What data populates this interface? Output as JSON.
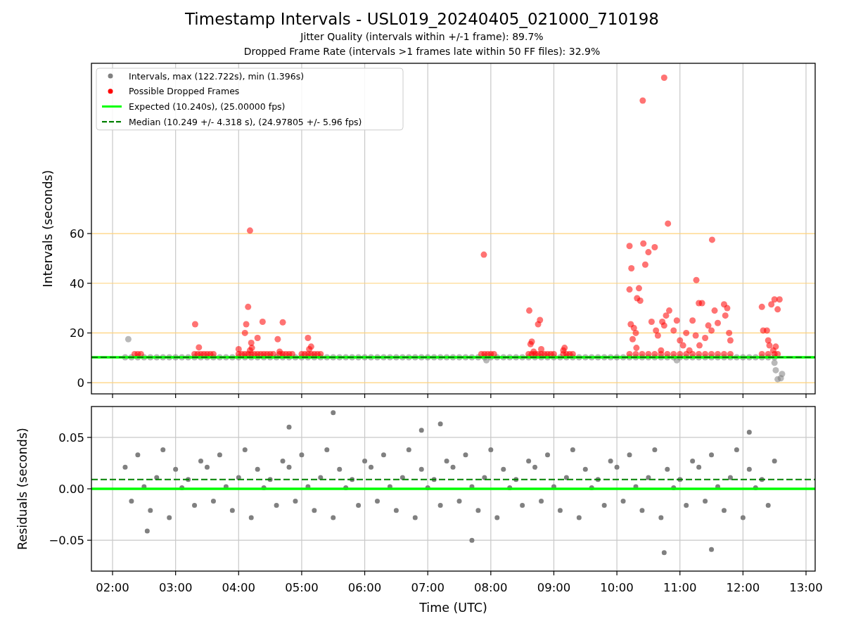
{
  "figure": {
    "title": "Timestamp Intervals - USL019_20240405_021000_710198",
    "subtitles": [
      "Jitter Quality (intervals within +/-1 frame): 89.7%",
      "Dropped Frame Rate (intervals >1 frames late within 50 FF files): 32.9%"
    ]
  },
  "panels": [
    {
      "chart_data": {
        "type": "scatter",
        "ylabel": "Intervals (seconds)",
        "xlim": [
          1.665,
          13.145
        ],
        "ylim": [
          -4.5,
          128.5
        ],
        "grid": true,
        "yticks": [
          0,
          20,
          40,
          60
        ],
        "series": [
          {
            "name": "Intervals, max (122.722s), min (1.396s)",
            "color": "#808080",
            "x": [
              2.2,
              2.3,
              2.4,
              2.5,
              2.6,
              2.7,
              2.8,
              2.9,
              3.0,
              3.1,
              3.2,
              3.3,
              3.4,
              3.5,
              3.6,
              3.7,
              3.8,
              3.9,
              4.0,
              4.1,
              4.2,
              4.3,
              4.4,
              4.5,
              4.6,
              4.7,
              4.8,
              4.9,
              5.0,
              5.1,
              5.2,
              5.3,
              5.4,
              5.5,
              5.6,
              5.7,
              5.8,
              5.9,
              6.0,
              6.1,
              6.2,
              6.3,
              6.4,
              6.5,
              6.6,
              6.7,
              6.8,
              6.9,
              7.0,
              7.1,
              7.2,
              7.3,
              7.4,
              7.5,
              7.6,
              7.7,
              7.8,
              7.9,
              8.0,
              8.1,
              8.2,
              8.3,
              8.4,
              8.5,
              8.6,
              8.7,
              8.8,
              8.9,
              9.0,
              9.1,
              9.2,
              9.3,
              9.4,
              9.5,
              9.6,
              9.7,
              9.8,
              9.9,
              10.0,
              10.1,
              10.2,
              10.3,
              10.4,
              10.5,
              10.6,
              10.7,
              10.8,
              10.9,
              11.0,
              11.1,
              11.2,
              11.3,
              11.4,
              11.5,
              11.6,
              11.7,
              11.8,
              11.9,
              12.0,
              12.1,
              12.2,
              12.3,
              12.4,
              12.5,
              2.25,
              7.93,
              10.95,
              12.5,
              12.52,
              12.55,
              12.6,
              12.62
            ],
            "values": [
              10.2,
              10.2,
              10.2,
              10.2,
              10.2,
              10.2,
              10.2,
              10.2,
              10.2,
              10.2,
              10.2,
              10.2,
              10.2,
              10.2,
              10.2,
              10.2,
              10.2,
              10.2,
              10.2,
              10.2,
              10.2,
              10.2,
              10.2,
              10.2,
              10.2,
              10.2,
              10.2,
              10.2,
              10.2,
              10.2,
              10.2,
              10.2,
              10.2,
              10.2,
              10.2,
              10.2,
              10.2,
              10.2,
              10.2,
              10.2,
              10.2,
              10.2,
              10.2,
              10.2,
              10.2,
              10.2,
              10.2,
              10.2,
              10.2,
              10.2,
              10.2,
              10.2,
              10.2,
              10.2,
              10.2,
              10.2,
              10.2,
              10.2,
              10.2,
              10.2,
              10.2,
              10.2,
              10.2,
              10.2,
              10.2,
              10.2,
              10.2,
              10.2,
              10.2,
              10.2,
              10.2,
              10.2,
              10.2,
              10.2,
              10.2,
              10.2,
              10.2,
              10.2,
              10.2,
              10.2,
              10.2,
              10.2,
              10.2,
              10.2,
              10.2,
              10.2,
              10.2,
              10.2,
              10.2,
              10.2,
              10.2,
              10.2,
              10.2,
              10.2,
              10.2,
              10.2,
              10.2,
              10.2,
              10.2,
              10.2,
              10.2,
              10.2,
              10.2,
              10.2,
              17.5,
              9.0,
              9.0,
              8,
              5,
              1.4,
              1.8,
              3.5
            ]
          },
          {
            "name": "Possible Dropped Frames",
            "color": "#ff0000",
            "x": [
              3.31,
              3.37,
              4.0,
              4.15,
              4.12,
              4.1,
              4.2,
              4.18,
              4.21,
              4.3,
              4.38,
              4.62,
              4.7,
              4.65,
              5.1,
              5.12,
              5.15,
              4.18,
              7.89,
              8.61,
              8.65,
              8.63,
              8.68,
              8.78,
              8.75,
              8.8,
              9.17,
              9.15,
              10.2,
              10.23,
              10.2,
              10.22,
              10.25,
              10.27,
              10.3,
              10.32,
              10.35,
              10.37,
              10.31,
              10.42,
              10.45,
              10.5,
              10.55,
              10.6,
              10.62,
              10.65,
              10.7,
              10.72,
              10.75,
              10.78,
              10.81,
              10.83,
              10.9,
              10.95,
              11.0,
              11.05,
              10.41,
              10.75,
              11.26,
              11.2,
              11.3,
              11.35,
              11.25,
              11.4,
              11.45,
              11.51,
              11.5,
              11.55,
              11.6,
              11.7,
              11.75,
              11.72,
              11.78,
              11.8,
              11.31,
              11.1,
              11.15,
              12.3,
              12.32,
              12.38,
              12.4,
              12.45,
              12.5,
              12.58,
              12.55,
              12.42,
              12.48,
              12.52,
              2.35,
              2.4,
              2.45,
              3.3,
              3.35,
              3.4,
              3.45,
              3.5,
              3.55,
              3.6,
              4.0,
              4.05,
              4.1,
              4.15,
              4.2,
              4.25,
              4.3,
              4.35,
              4.4,
              4.45,
              4.5,
              4.55,
              4.65,
              4.7,
              4.75,
              4.8,
              4.85,
              5.0,
              5.05,
              5.1,
              5.15,
              5.2,
              5.25,
              5.3,
              7.85,
              7.9,
              7.95,
              8.0,
              8.05,
              8.6,
              8.65,
              8.7,
              8.75,
              8.8,
              8.85,
              8.9,
              8.95,
              9.0,
              9.15,
              9.2,
              9.25,
              9.3,
              10.2,
              10.3,
              10.4,
              10.5,
              10.6,
              10.7,
              10.8,
              10.9,
              11.0,
              11.1,
              11.2,
              11.3,
              11.4,
              11.5,
              11.6,
              11.7,
              11.8,
              12.3,
              12.4,
              12.5,
              12.55
            ],
            "values": [
              23.5,
              14.2,
              13.5,
              30.5,
              23.5,
              20,
              16,
              13,
              14,
              18,
              24.5,
              17.5,
              24.3,
              12.5,
              18,
              13.5,
              14.5,
              61.2,
              51.5,
              29,
              16.5,
              15.5,
              12.5,
              25.2,
              23.5,
              13.5,
              14,
              13,
              55,
              46,
              37.5,
              23.5,
              17.5,
              22,
              20,
              34,
              38,
              33,
              14,
              56,
              47.5,
              52.5,
              24.5,
              54.5,
              21,
              19,
              13,
              24.5,
              23,
              27,
              64,
              29,
              21,
              25,
              17,
              15,
              113.5,
              122.7,
              41.3,
              25,
              32,
              32,
              19,
              18,
              23,
              57.5,
              21,
              29,
              24,
              31.5,
              30,
              27,
              20,
              17,
              15,
              20,
              13,
              30.5,
              21,
              21,
              17,
              31.5,
              33.5,
              33.5,
              29.5,
              15,
              13,
              14.5,
              11.5,
              11.5,
              11.5,
              11.5,
              11.5,
              11.5,
              11.5,
              11.5,
              11.5,
              11.5,
              11.5,
              11.5,
              11.5,
              11.5,
              11.5,
              11.5,
              11.5,
              11.5,
              11.5,
              11.5,
              11.5,
              11.5,
              11.5,
              11.5,
              11.5,
              11.5,
              11.5,
              11.5,
              11.5,
              11.5,
              11.5,
              11.5,
              11.5,
              11.5,
              11.5,
              11.5,
              11.5,
              11.5,
              11.5,
              11.5,
              11.5,
              11.5,
              11.5,
              11.5,
              11.5,
              11.5,
              11.5,
              11.5,
              11.5,
              11.5,
              11.5,
              11.5,
              11.5,
              11.5,
              11.5,
              11.5,
              11.5,
              11.5,
              11.5,
              11.5,
              11.5,
              11.5,
              11.5,
              11.5,
              11.5,
              11.5,
              11.5,
              11.5,
              11.5,
              11.5,
              11.5,
              11.5,
              11.5
            ]
          }
        ],
        "legend": true,
        "ref_lines": [
          {
            "label": "Expected (10.240s), (25.00000 fps)",
            "axis": "y",
            "value": 10.24,
            "color": "#00ff00"
          },
          {
            "label": "Median (10.249 +/- 4.318 s), (24.97805 +/- 5.96 fps)",
            "axis": "y",
            "value": 10.249,
            "color": "#008000"
          }
        ]
      }
    },
    {
      "chart_data": {
        "type": "scatter",
        "xlabel": "Time (UTC)",
        "ylabel": "Residuals (seconds)",
        "xlim": [
          1.665,
          13.145
        ],
        "ylim": [
          -0.08,
          0.08
        ],
        "grid": true,
        "xticks": [
          {
            "value": 2,
            "label": "02:00"
          },
          {
            "value": 3,
            "label": "03:00"
          },
          {
            "value": 4,
            "label": "04:00"
          },
          {
            "value": 5,
            "label": "05:00"
          },
          {
            "value": 6,
            "label": "06:00"
          },
          {
            "value": 7,
            "label": "07:00"
          },
          {
            "value": 8,
            "label": "08:00"
          },
          {
            "value": 9,
            "label": "09:00"
          },
          {
            "value": 10,
            "label": "10:00"
          },
          {
            "value": 11,
            "label": "11:00"
          },
          {
            "value": 12,
            "label": "12:00"
          },
          {
            "value": 13,
            "label": "13:00"
          }
        ],
        "yticks": [
          {
            "value": -0.05,
            "label": "−0.05"
          },
          {
            "value": 0,
            "label": "0.00"
          },
          {
            "value": 0.05,
            "label": "0.05"
          }
        ],
        "series": [
          {
            "color": "#808080",
            "x": [
              2.2,
              2.3,
              2.4,
              2.5,
              2.6,
              2.7,
              2.8,
              2.9,
              3.0,
              3.1,
              3.2,
              3.3,
              3.4,
              3.5,
              3.6,
              3.7,
              3.8,
              3.9,
              4.0,
              4.1,
              4.2,
              4.3,
              4.4,
              4.5,
              4.6,
              4.7,
              4.8,
              4.9,
              5.0,
              5.1,
              5.2,
              5.3,
              5.4,
              5.5,
              5.6,
              5.7,
              5.8,
              5.9,
              6.0,
              6.1,
              6.2,
              6.3,
              6.4,
              6.5,
              6.6,
              6.7,
              6.8,
              6.9,
              7.0,
              7.1,
              7.2,
              7.3,
              7.4,
              7.5,
              7.6,
              7.7,
              7.8,
              7.9,
              8.0,
              8.1,
              8.2,
              8.3,
              8.4,
              8.5,
              8.6,
              8.7,
              8.8,
              8.9,
              9.0,
              9.1,
              9.2,
              9.3,
              9.4,
              9.5,
              9.6,
              9.7,
              9.8,
              9.9,
              10.0,
              10.1,
              10.2,
              10.3,
              10.4,
              10.5,
              10.6,
              10.7,
              10.8,
              10.9,
              11.0,
              11.1,
              11.2,
              11.3,
              11.4,
              11.5,
              11.6,
              11.7,
              11.8,
              11.9,
              12.0,
              12.1,
              12.2,
              12.3,
              12.4,
              12.5,
              5.5,
              7.7,
              10.75,
              11.5,
              7.2,
              4.8,
              2.55,
              6.9,
              12.1
            ],
            "values": [
              0.021,
              -0.012,
              0.033,
              0.002,
              -0.021,
              0.011,
              0.038,
              -0.028,
              0.019,
              0.001,
              0.009,
              -0.016,
              0.027,
              0.021,
              -0.012,
              0.033,
              0.002,
              -0.021,
              0.011,
              0.038,
              -0.028,
              0.019,
              0.001,
              0.009,
              -0.016,
              0.027,
              0.021,
              -0.012,
              0.033,
              0.002,
              -0.021,
              0.011,
              0.038,
              -0.028,
              0.019,
              0.001,
              0.009,
              -0.016,
              0.027,
              0.021,
              -0.012,
              0.033,
              0.002,
              -0.021,
              0.011,
              0.038,
              -0.028,
              0.019,
              0.001,
              0.009,
              -0.016,
              0.027,
              0.021,
              -0.012,
              0.033,
              0.002,
              -0.021,
              0.011,
              0.038,
              -0.028,
              0.019,
              0.001,
              0.009,
              -0.016,
              0.027,
              0.021,
              -0.012,
              0.033,
              0.002,
              -0.021,
              0.011,
              0.038,
              -0.028,
              0.019,
              0.001,
              0.009,
              -0.016,
              0.027,
              0.021,
              -0.012,
              0.033,
              0.002,
              -0.021,
              0.011,
              0.038,
              -0.028,
              0.019,
              0.001,
              0.009,
              -0.016,
              0.027,
              0.021,
              -0.012,
              0.033,
              0.002,
              -0.021,
              0.011,
              0.038,
              -0.028,
              0.019,
              0.001,
              0.009,
              -0.016,
              0.027,
              0.074,
              -0.05,
              -0.062,
              -0.059,
              0.063,
              0.06,
              -0.041,
              0.057,
              0.055
            ]
          }
        ],
        "ref_lines": [
          {
            "axis": "y",
            "value": 0,
            "color": "#00ff00"
          },
          {
            "axis": "y",
            "value": 0.009,
            "color": "#008000"
          }
        ]
      }
    }
  ]
}
